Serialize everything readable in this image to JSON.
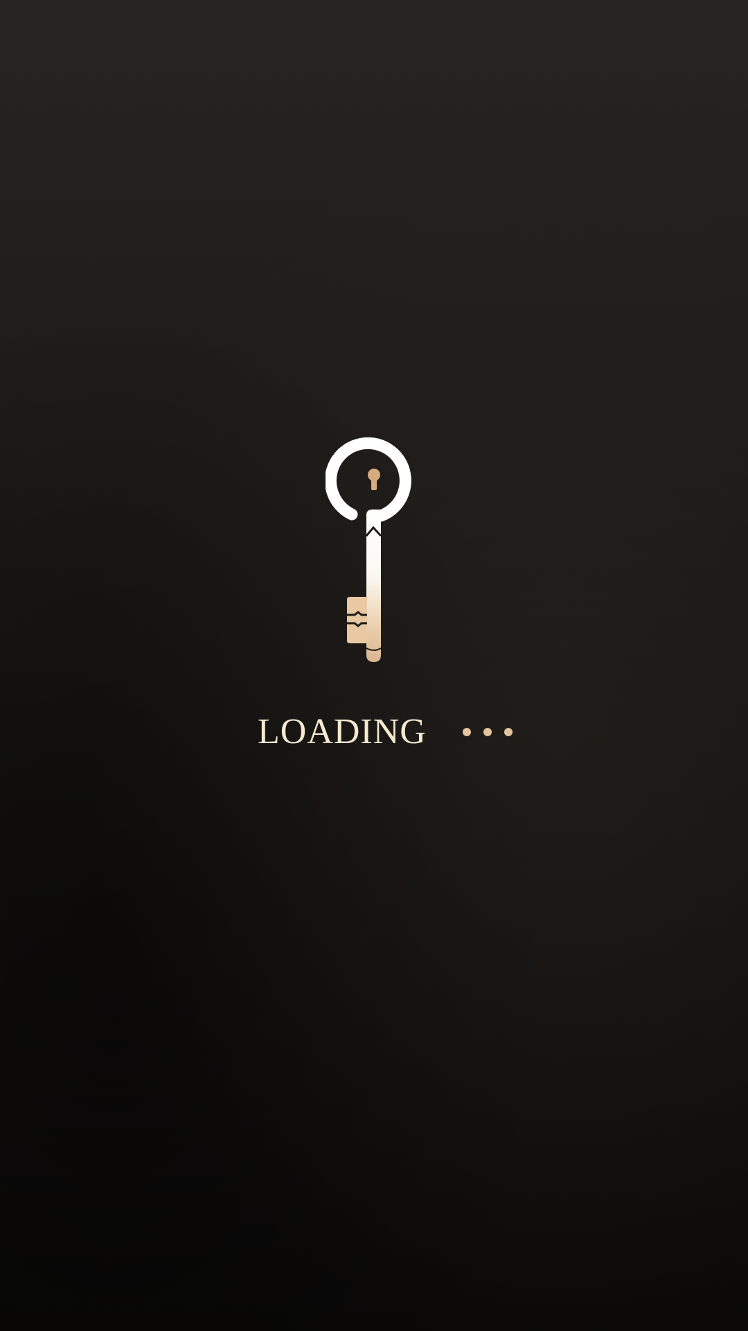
{
  "loading": {
    "label": "LOADING",
    "dots_count": 3
  },
  "icons": {
    "logo": "key-icon"
  },
  "colors": {
    "text": "#f3ead0",
    "accent": "#e3c59d",
    "background_top": "#272521",
    "background_bottom": "#0a0908"
  }
}
